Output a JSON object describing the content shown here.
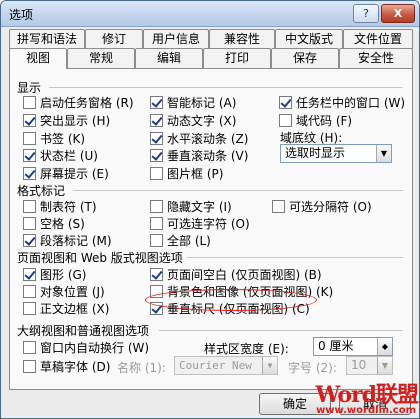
{
  "window": {
    "title": "选项",
    "help_glyph": "?",
    "close_glyph": "X"
  },
  "tabs_back": [
    "拼写和语法",
    "修订",
    "用户信息",
    "兼容性",
    "中文版式",
    "文件位置"
  ],
  "tabs_front": [
    "视图",
    "常规",
    "编辑",
    "打印",
    "保存",
    "安全性"
  ],
  "active_tab": "视图",
  "sections": {
    "display": {
      "title": "显示",
      "items": [
        {
          "label": "启动任务窗格 (R)",
          "checked": false
        },
        {
          "label": "突出显示 (H)",
          "checked": true
        },
        {
          "label": "书签 (K)",
          "checked": false
        },
        {
          "label": "状态栏 (U)",
          "checked": true
        },
        {
          "label": "屏幕提示 (E)",
          "checked": true
        },
        {
          "label": "智能标记 (A)",
          "checked": true
        },
        {
          "label": "动态文字 (X)",
          "checked": true
        },
        {
          "label": "水平滚动条 (Z)",
          "checked": true
        },
        {
          "label": "垂直滚动条 (V)",
          "checked": true
        },
        {
          "label": "图片框 (P)",
          "checked": false
        },
        {
          "label": "任务栏中的窗口 (W)",
          "checked": true
        },
        {
          "label": "域代码 (F)",
          "checked": false
        }
      ],
      "field_shading_label": "域底纹 (H):",
      "field_shading_value": "选取时显示"
    },
    "format": {
      "title": "格式标记",
      "items": [
        {
          "label": "制表符 (T)",
          "checked": false
        },
        {
          "label": "空格 (S)",
          "checked": false
        },
        {
          "label": "段落标记 (M)",
          "checked": true
        },
        {
          "label": "隐藏文字 (I)",
          "checked": false
        },
        {
          "label": "可选连字符 (O)",
          "checked": false
        },
        {
          "label": "全部 (L)",
          "checked": false
        },
        {
          "label": "可选分隔符 (O)",
          "checked": false
        }
      ]
    },
    "print_layout": {
      "title": "页面视图和 Web 版式视图选项",
      "items": [
        {
          "label": "图形 (G)",
          "checked": true
        },
        {
          "label": "对象位置 (J)",
          "checked": false
        },
        {
          "label": "正文边框 (X)",
          "checked": false
        },
        {
          "label": "页面间空白 (仅页面视图) (B)",
          "checked": true
        },
        {
          "label": "背景色和图像 (仅页面视图) (K)",
          "checked": false
        },
        {
          "label": "垂直标尺 (仅页面视图) (C)",
          "checked": true
        }
      ]
    },
    "outline": {
      "title": "大纲视图和普通视图选项",
      "items": [
        {
          "label": "窗口内自动换行 (W)",
          "checked": false
        },
        {
          "label": "草稿字体 (D)",
          "checked": false
        }
      ],
      "style_width_label": "样式区宽度 (E):",
      "style_width_value": "0 厘米",
      "name_label": "名称 (1):",
      "name_value": "Courier New",
      "size_label": "字号 (2):",
      "size_value": "10"
    }
  },
  "buttons": {
    "ok": "确定",
    "cancel": "取消"
  },
  "watermark": {
    "brand": "Word联盟",
    "url": "www.wordlm.com"
  }
}
